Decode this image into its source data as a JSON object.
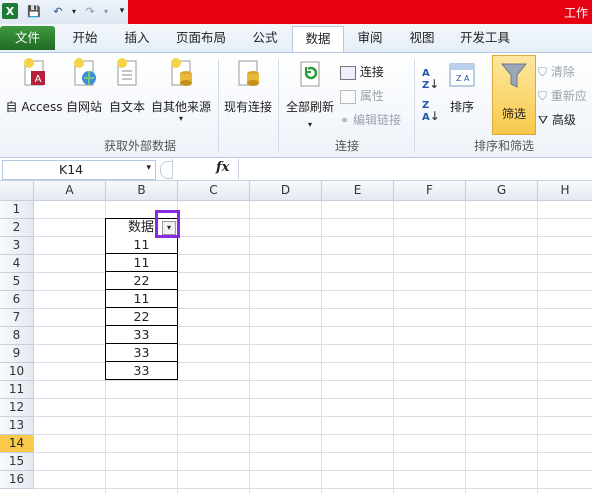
{
  "title_bar": {
    "title": "工作"
  },
  "tabs": [
    "文件",
    "开始",
    "插入",
    "页面布局",
    "公式",
    "数据",
    "审阅",
    "视图",
    "开发工具"
  ],
  "active_tab": "数据",
  "ribbon": {
    "get_external": {
      "buttons": [
        "自 Access",
        "自网站",
        "自文本",
        "自其他来源",
        "现有连接"
      ],
      "group_label": "获取外部数据"
    },
    "connections": {
      "refresh_all": "全部刷新",
      "connect": "连接",
      "properties": "属性",
      "edit_links": "编辑链接",
      "group_label": "连接"
    },
    "sort_filter": {
      "sort": "排序",
      "filter": "筛选",
      "clear": "清除",
      "reapply": "重新应",
      "advanced": "高级",
      "group_label": "排序和筛选"
    }
  },
  "formula_bar": {
    "name_box": "K14",
    "fx": "fx",
    "formula": ""
  },
  "sheet": {
    "columns": [
      "A",
      "B",
      "C",
      "D",
      "E",
      "F",
      "G",
      "H"
    ],
    "rows": [
      "1",
      "2",
      "3",
      "4",
      "5",
      "6",
      "7",
      "8",
      "9",
      "10",
      "11",
      "12",
      "13",
      "14",
      "15",
      "16"
    ],
    "selected_row": "14",
    "header_cell": "数据",
    "values": [
      "11",
      "11",
      "22",
      "11",
      "22",
      "33",
      "33",
      "33"
    ]
  },
  "colors": {
    "accent_red": "#e60012",
    "file_tab": "#2e7d32",
    "highlight_box": "#8a2be2",
    "selected_row": "#f8c94a"
  }
}
